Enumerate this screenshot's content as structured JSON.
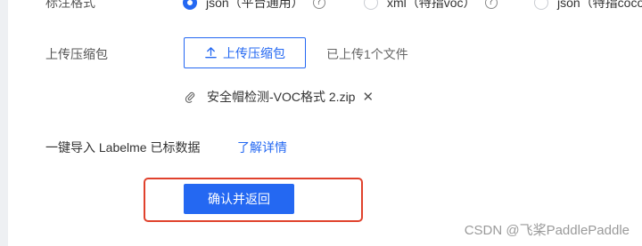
{
  "format_row": {
    "label": "标注格式",
    "options": [
      {
        "text": "json（平台通用）",
        "checked": true
      },
      {
        "text": "xml（特指voc）",
        "checked": false
      },
      {
        "text": "json（特指coco）",
        "checked": false
      }
    ],
    "help_glyph": "?"
  },
  "upload": {
    "label": "上传压缩包",
    "button_label": "上传压缩包",
    "status": "已上传1个文件"
  },
  "file": {
    "name": "安全帽检测-VOC格式 2.zip",
    "remove_glyph": "✕"
  },
  "labelme": {
    "label": "一键导入 Labelme 已标数据",
    "link": "了解详情"
  },
  "confirm_button": "确认并返回",
  "watermark": "CSDN @飞桨PaddlePaddle",
  "colors": {
    "accent": "#2468f2",
    "highlight": "#e0412c"
  }
}
